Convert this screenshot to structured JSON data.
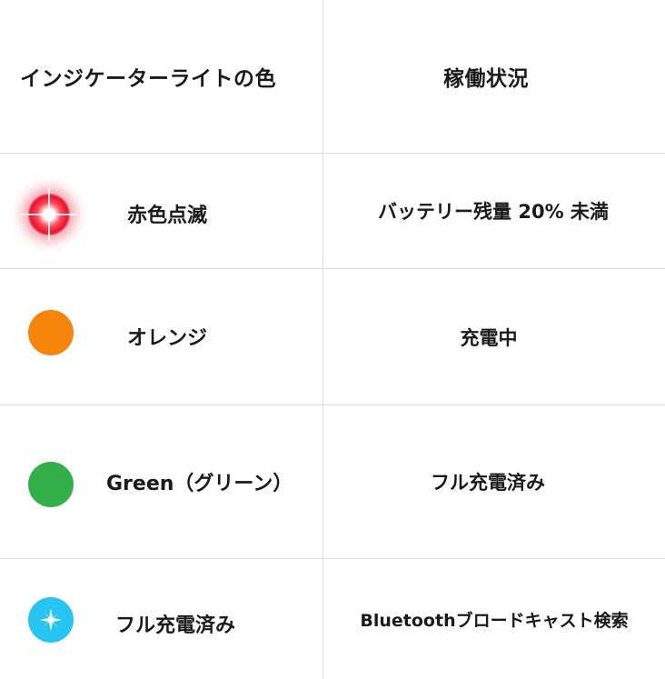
{
  "header": {
    "col_color": "インジケーターライトの色",
    "col_status": "稼働状況"
  },
  "rows": [
    {
      "indicator_icon": "red-blinking-light-icon",
      "indicator_color": "#e8142c",
      "color_label": "赤色点滅",
      "status": "バッテリー残量 20% 未満"
    },
    {
      "indicator_icon": "orange-light-icon",
      "indicator_color": "#f5840b",
      "color_label": "オレンジ",
      "status": "充電中"
    },
    {
      "indicator_icon": "green-light-icon",
      "indicator_color": "#34b04a",
      "color_label": "Green（グリーン）",
      "status": "フル充電済み"
    },
    {
      "indicator_icon": "blue-flashing-light-icon",
      "indicator_color": "#27c4f2",
      "color_label": "フル充電済み",
      "status": "Bluetoothブロードキャスト検索"
    }
  ]
}
